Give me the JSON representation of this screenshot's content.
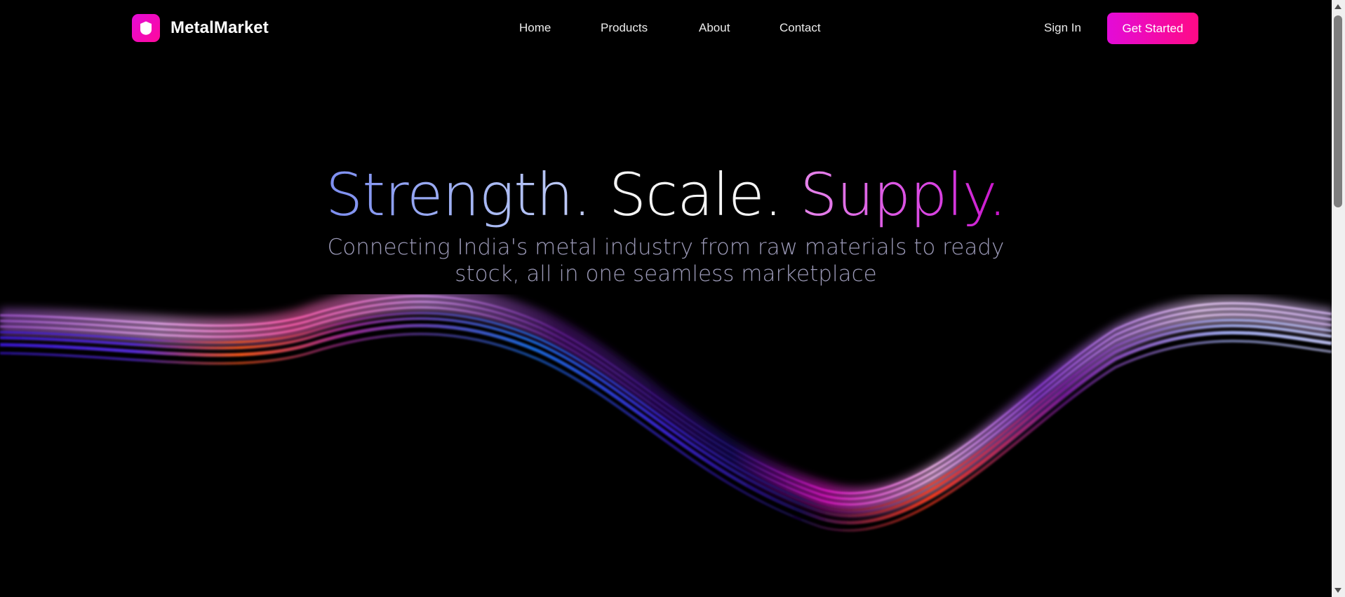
{
  "brand": {
    "name": "MetalMarket",
    "logo_icon": "shield-icon",
    "accent_colors": [
      "#e30bd8",
      "#ff0a86"
    ]
  },
  "nav": {
    "items": [
      {
        "label": "Home"
      },
      {
        "label": "Products"
      },
      {
        "label": "About"
      },
      {
        "label": "Contact"
      }
    ]
  },
  "auth": {
    "sign_in_label": "Sign In",
    "cta_label": "Get Started"
  },
  "hero": {
    "title_part1": "Strength.",
    "title_part2": "Scale.",
    "title_part3": "Supply.",
    "subtitle": "Connecting India's metal industry from raw materials to ready stock, all in one seamless marketplace"
  },
  "colors": {
    "background": "#000000",
    "title_blue": "#9db0f3",
    "title_white": "#f4f4f4",
    "title_magenta": "#d73ee0",
    "subtitle": "#9c9ab8"
  }
}
